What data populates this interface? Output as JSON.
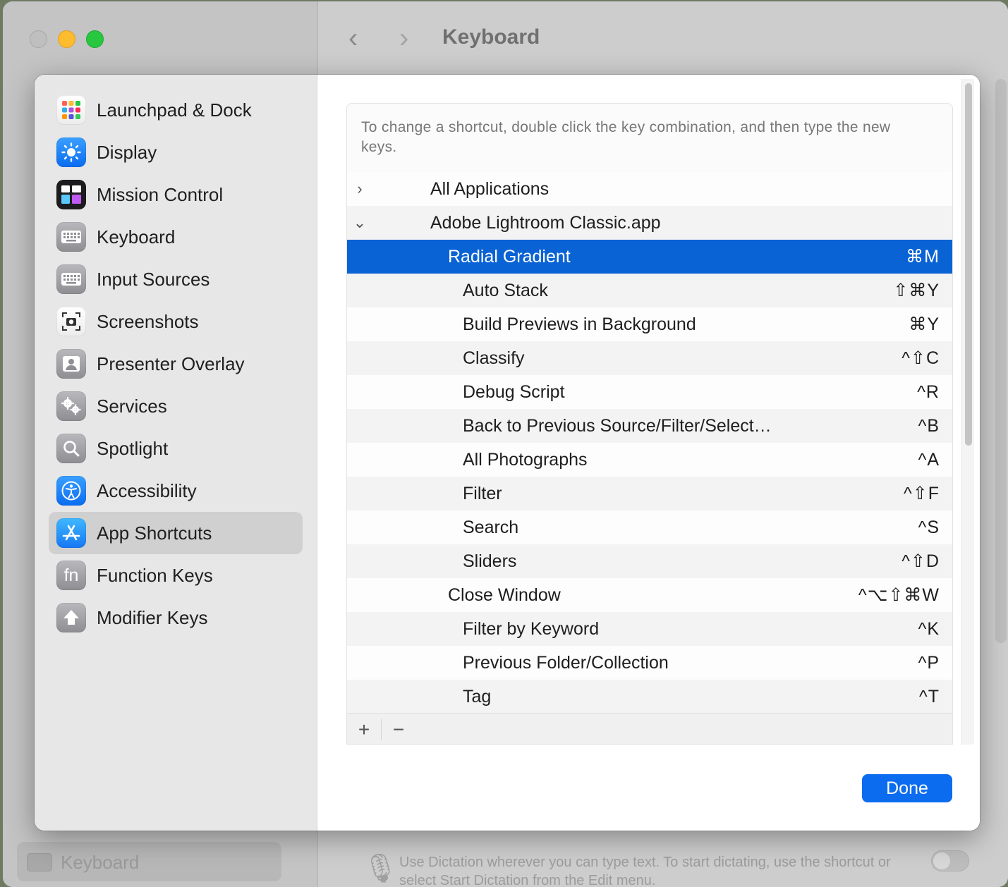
{
  "window": {
    "title": "Keyboard"
  },
  "background": {
    "sidebar_bottom_label": "Keyboard",
    "dictation_text": "Use Dictation wherever you can type text. To start dictating, use the shortcut or select Start Dictation from the Edit menu."
  },
  "sidebar": {
    "items": [
      {
        "label": "Launchpad & Dock",
        "icon": "launchpad-icon"
      },
      {
        "label": "Display",
        "icon": "sun-icon"
      },
      {
        "label": "Mission Control",
        "icon": "mission-control-icon"
      },
      {
        "label": "Keyboard",
        "icon": "keyboard-icon"
      },
      {
        "label": "Input Sources",
        "icon": "keyboard-icon"
      },
      {
        "label": "Screenshots",
        "icon": "camera-icon"
      },
      {
        "label": "Presenter Overlay",
        "icon": "person-icon"
      },
      {
        "label": "Services",
        "icon": "gears-icon"
      },
      {
        "label": "Spotlight",
        "icon": "magnifier-icon"
      },
      {
        "label": "Accessibility",
        "icon": "accessibility-icon"
      },
      {
        "label": "App Shortcuts",
        "icon": "app-store-icon",
        "selected": true
      },
      {
        "label": "Function Keys",
        "icon": "fn-icon",
        "glyph": "fn"
      },
      {
        "label": "Modifier Keys",
        "icon": "up-arrow-icon"
      }
    ]
  },
  "main": {
    "hint": "To change a shortcut, double click the key combination, and then type the new keys.",
    "rows": [
      {
        "label": "All Applications",
        "keys": "",
        "disclosure": "›",
        "level": 0
      },
      {
        "label": "Adobe Lightroom Classic.app",
        "keys": "",
        "disclosure": "⌄",
        "level": 0
      },
      {
        "label": "Radial Gradient",
        "keys": "⌘M",
        "level": 1,
        "selected": true
      },
      {
        "label": "Auto Stack",
        "keys": "⇧⌘Y",
        "level": 2
      },
      {
        "label": "Build Previews in Background",
        "keys": "⌘Y",
        "level": 2
      },
      {
        "label": "Classify",
        "keys": "^⇧C",
        "level": 2
      },
      {
        "label": "Debug Script",
        "keys": "^R",
        "level": 2
      },
      {
        "label": "Back to Previous Source/Filter/Select…",
        "keys": "^B",
        "level": 2
      },
      {
        "label": "All Photographs",
        "keys": "^A",
        "level": 2
      },
      {
        "label": "Filter",
        "keys": "^⇧F",
        "level": 2
      },
      {
        "label": "Search",
        "keys": "^S",
        "level": 2
      },
      {
        "label": "Sliders",
        "keys": "^⇧D",
        "level": 2
      },
      {
        "label": "Close Window",
        "keys": "^⌥⇧⌘W",
        "level": 1
      },
      {
        "label": "Filter by Keyword",
        "keys": "^K",
        "level": 2
      },
      {
        "label": "Previous Folder/Collection",
        "keys": "^P",
        "level": 2
      },
      {
        "label": "Tag",
        "keys": "^T",
        "level": 2
      }
    ],
    "toolbar": {
      "add_label": "+",
      "remove_label": "−"
    },
    "done_label": "Done"
  },
  "colors": {
    "accent": "#0a63d4",
    "done_button": "#0b6cf0"
  }
}
